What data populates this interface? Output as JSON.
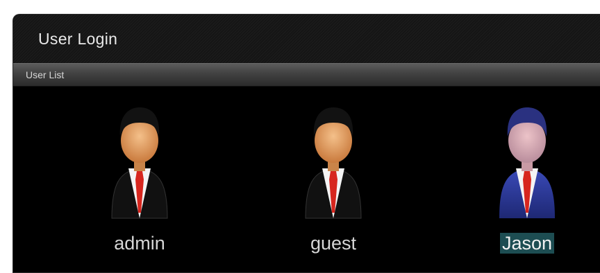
{
  "window": {
    "title": "User Login"
  },
  "user_list": {
    "header": "User List",
    "users": [
      {
        "name": "admin",
        "selected": false,
        "icon": "user-avatar-icon"
      },
      {
        "name": "guest",
        "selected": false,
        "icon": "user-avatar-icon"
      },
      {
        "name": "Jason",
        "selected": true,
        "icon": "user-avatar-icon"
      }
    ]
  },
  "colors": {
    "background": "#000000",
    "selection": "#1d4d52",
    "suit_normal": "#111111",
    "suit_selected": "#2c3a9a",
    "skin_normal": "#e7a66e",
    "skin_selected": "#d9a4ad"
  }
}
